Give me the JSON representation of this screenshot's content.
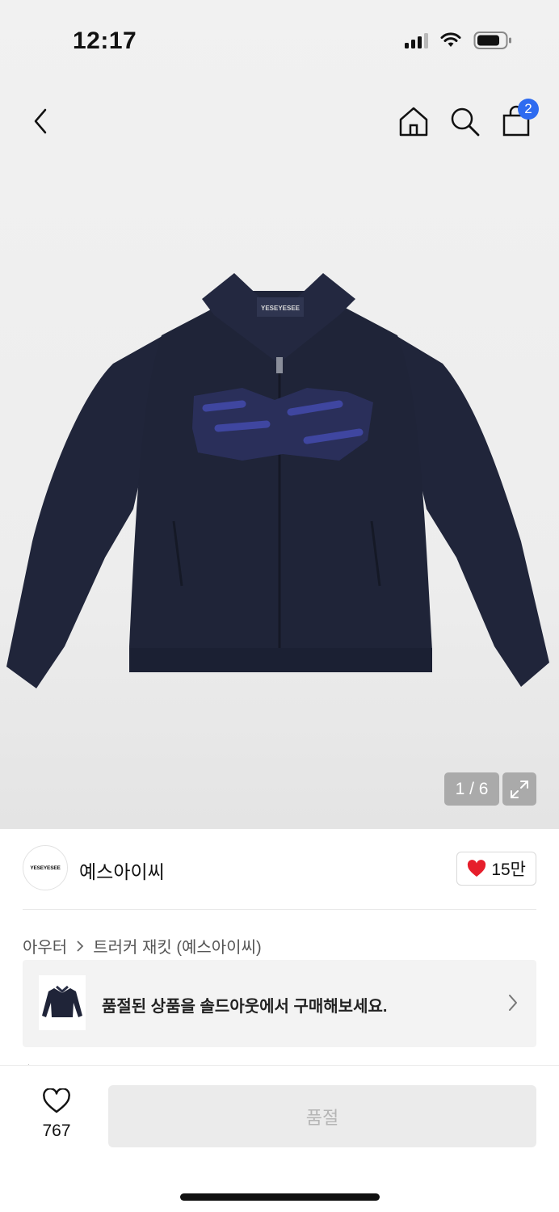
{
  "status_bar": {
    "time": "12:17"
  },
  "header": {
    "back_icon": "chevron-left-icon",
    "home_icon": "home-icon",
    "search_icon": "search-icon",
    "cart_icon": "shopping-bag-icon",
    "cart_count": "2",
    "badge_color": "#2e6bf0"
  },
  "gallery": {
    "counter": "1 / 6",
    "expand_icon": "expand-icon"
  },
  "brand": {
    "logo_text": "YESEYESEE",
    "name": "예스아이씨",
    "like_count": "15만",
    "heart_color": "#e61e2b"
  },
  "breadcrumb": {
    "category": "아우터",
    "product": "트러커 재킷 (예스아이씨)"
  },
  "soldout_banner": {
    "message": "품절된 상품을 솔드아웃에서 구매해보세요."
  },
  "bottom_bar": {
    "wish_count": "767",
    "buy_label": "품절"
  }
}
